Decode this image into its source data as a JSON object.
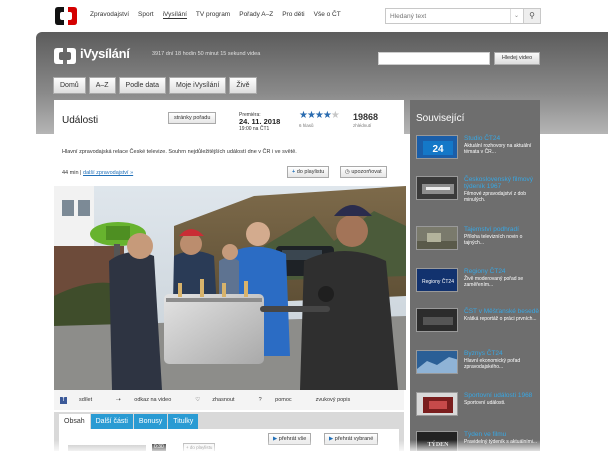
{
  "topnav": {
    "items": [
      "Zpravodajství",
      "Sport",
      "iVysílání",
      "TV program",
      "Pořady A–Z",
      "Pro děti",
      "Vše o ČT"
    ],
    "search_placeholder": "Hledaný text"
  },
  "header": {
    "title": "iVysílání",
    "counter": "3917 dní 18 hodin 50 minut 15 sekund videa",
    "search_button": "Hledej video"
  },
  "mainnav": {
    "items": [
      "Domů",
      "A–Z",
      "Podle data",
      "Moje iVysílání",
      "Živě"
    ]
  },
  "program": {
    "title": "Události",
    "pages_button": "stránky pořadu",
    "premiere_label": "Premiéra:",
    "premiere_date": "24. 11. 2018",
    "premiere_time": "19:00 na ČT1",
    "rating": {
      "stars": 4,
      "max": 5,
      "votes": "6 hlasů"
    },
    "views": "19868",
    "views_label": "zhlédnutí",
    "description": "Hlavní zpravodajská relace České televize. Souhrn nejdůležitějších událostí dne v ČR i ve světě.",
    "duration": "44 min",
    "more_parts": "další zpravodajství »",
    "playlist_button": "do playlistu",
    "notify_button": "upozorňovat"
  },
  "share": {
    "share": "sdílet",
    "link": "odkaz na video",
    "zoom": "zhasnout",
    "help": "pomoc",
    "audio": "zvukový popis"
  },
  "tabs": [
    "Obsah",
    "Další části",
    "Bonusy",
    "Titulky"
  ],
  "tab_content": {
    "play_all": "přehrát vše",
    "play_selected": "přehrát vybrané",
    "time": "0:30",
    "add": "do playlistu"
  },
  "sidebar": {
    "title": "Související",
    "items": [
      {
        "title": "Studio ČT24",
        "desc": "Aktuální rozhovory na aktuální témata v ČR...",
        "thumb": "ct24"
      },
      {
        "title": "Československý filmový týdeník 1967",
        "desc": "Filmové zpravodajství z dob minulých.",
        "thumb": "bw"
      },
      {
        "title": "Tajemství podhradí",
        "desc": "Příloha televizních novin o tajných...",
        "thumb": "village"
      },
      {
        "title": "Regiony ČT24",
        "desc": "Živě moderovaný pořad se zaměřením...",
        "thumb": "regiony"
      },
      {
        "title": "ČST v Měšťanské besedě",
        "desc": "Krátká reportáž o práci prvních...",
        "thumb": "dark"
      },
      {
        "title": "Byznys ČT24",
        "desc": "Hlavní ekonomický pořad zpravodajského...",
        "thumb": "byznys"
      },
      {
        "title": "Sportovní události 1968",
        "desc": "Sportovní události.",
        "thumb": "sport"
      },
      {
        "title": "Týden ve filmu",
        "desc": "Pravidelný týdeník s aktuálními...",
        "thumb": "tyden"
      }
    ]
  },
  "colors": {
    "accent": "#2a9bd3",
    "link": "#1f6fb8",
    "sidebar_title": "#37a7e4"
  }
}
